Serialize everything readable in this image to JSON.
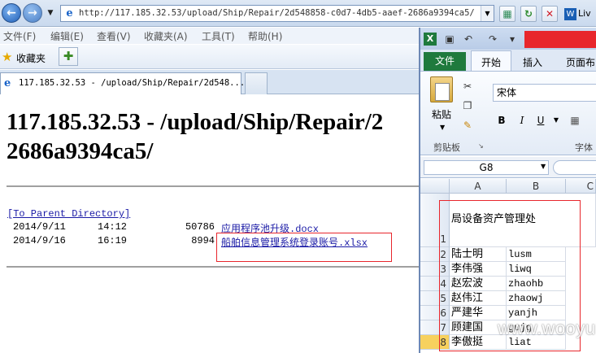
{
  "browser": {
    "address": "http://117.185.32.53/upload/Ship/Repair/2d548858-c0d7-4db5-aaef-2686a9394ca5/",
    "live_label": "Liv",
    "menu": [
      "文件(F)",
      "编辑(E)",
      "查看(V)",
      "收藏夹(A)",
      "工具(T)",
      "帮助(H)"
    ],
    "favorites_label": "收藏夹",
    "tab_title": "117.185.32.53 - /upload/Ship/Repair/2d548..."
  },
  "page": {
    "title_line1": "117.185.32.53 - /upload/Ship/Repair/2",
    "title_line2": "2686a9394ca5/",
    "parent_link": "[To Parent Directory]",
    "files": [
      {
        "date": "2014/9/11",
        "time": "14:12",
        "size": "50786",
        "name": "应用程序池升级.docx"
      },
      {
        "date": "2014/9/16",
        "time": "16:19",
        "size": "8994",
        "name": "船舶信息管理系统登录账号.xlsx"
      }
    ]
  },
  "excel": {
    "file_tab": "文件",
    "tabs": [
      "开始",
      "插入",
      "页面布"
    ],
    "paste_label": "粘贴",
    "clipboard_label": "剪贴板",
    "font_name": "宋体",
    "font_group_label": "字体",
    "bold": "B",
    "italic": "I",
    "underline": "U",
    "name_box": "G8",
    "columns": [
      "A",
      "B",
      "C"
    ],
    "rows": [
      {
        "n": "1",
        "a": "局设备资产管理处",
        "b": ""
      },
      {
        "n": "2",
        "a": "陆士明",
        "b": "lusm"
      },
      {
        "n": "3",
        "a": "李伟强",
        "b": "liwq"
      },
      {
        "n": "4",
        "a": "赵宏波",
        "b": "zhaohb"
      },
      {
        "n": "5",
        "a": "赵伟江",
        "b": "zhaowj"
      },
      {
        "n": "6",
        "a": "严建华",
        "b": "yanjh"
      },
      {
        "n": "7",
        "a": "顾建国",
        "b": "gujg"
      },
      {
        "n": "8",
        "a": "李傲挺",
        "b": "liat"
      }
    ]
  },
  "watermark": "www.wooyun.org"
}
